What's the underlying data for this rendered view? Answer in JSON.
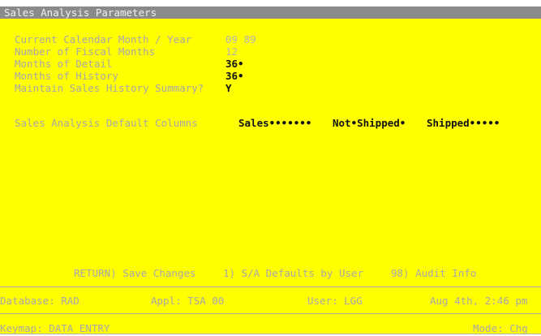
{
  "window": {
    "title": "Sales Analysis Parameters"
  },
  "form": {
    "fields": [
      {
        "label": "Current Calendar Month / Year",
        "value": "09 89"
      },
      {
        "label": "Number of Fiscal Months",
        "value": "12"
      },
      {
        "label": "Months of Detail",
        "value": "36•"
      },
      {
        "label": "Months of History",
        "value": "36•"
      },
      {
        "label": "Maintain Sales History Summary?",
        "value": "Y"
      }
    ],
    "default_columns": {
      "label": "Sales Analysis Default Columns",
      "columns": [
        "Sales•••••••",
        "Not•Shipped•",
        "Shipped•••••"
      ]
    }
  },
  "commands": {
    "save": "RETURN) Save Changes",
    "defaults_by_user": "1) S/A Defaults by User",
    "audit_info": "98) Audit Info"
  },
  "status_bar": {
    "database": "Database: RAD",
    "application": "Appl: TSA 00",
    "user": "User: LGG",
    "datetime": "Aug 4th, 2:46 pm"
  },
  "keymap_bar": {
    "keymap": "Keymap: DATA ENTRY",
    "mode": "Mode: Chg"
  }
}
